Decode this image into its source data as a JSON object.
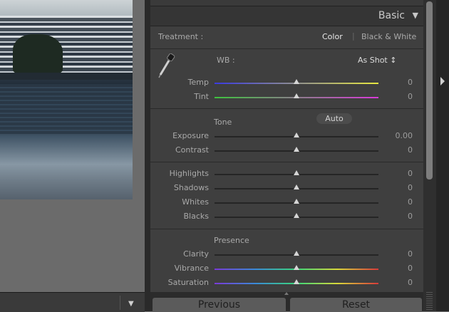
{
  "panel": {
    "title": "Basic",
    "treatment": {
      "label": "Treatment :",
      "options": [
        "Color",
        "Black & White"
      ],
      "active": "Color"
    },
    "wb": {
      "label": "WB :",
      "value": "As Shot ↕",
      "icon": "eyedropper-icon"
    },
    "wb_sliders": [
      {
        "label": "Temp",
        "value": "0",
        "level": 0.5,
        "track": "temp"
      },
      {
        "label": "Tint",
        "value": "0",
        "level": 0.5,
        "track": "tint"
      }
    ],
    "tone": {
      "label": "Tone",
      "auto_label": "Auto",
      "sliders": [
        {
          "label": "Exposure",
          "value": "0.00",
          "level": 0.5
        },
        {
          "label": "Contrast",
          "value": "0",
          "level": 0.5
        }
      ]
    },
    "tone2": {
      "sliders": [
        {
          "label": "Highlights",
          "value": "0",
          "level": 0.5
        },
        {
          "label": "Shadows",
          "value": "0",
          "level": 0.5
        },
        {
          "label": "Whites",
          "value": "0",
          "level": 0.5
        },
        {
          "label": "Blacks",
          "value": "0",
          "level": 0.5
        }
      ]
    },
    "presence": {
      "label": "Presence",
      "sliders": [
        {
          "label": "Clarity",
          "value": "0",
          "level": 0.5,
          "track": "plain"
        },
        {
          "label": "Vibrance",
          "value": "0",
          "level": 0.5,
          "track": "spectrum"
        },
        {
          "label": "Saturation",
          "value": "0",
          "level": 0.5,
          "track": "spectrum"
        }
      ]
    }
  },
  "buttons": {
    "previous": "Previous",
    "reset": "Reset"
  },
  "colors": {
    "temp_track": [
      "#3a3ae0",
      "#e6e640"
    ],
    "tint_track": [
      "#3ec23e",
      "#d83ad8"
    ],
    "spectrum_track": [
      "#7a3ad8",
      "#3a8ad8",
      "#3ad87a",
      "#d8d83a",
      "#d83a3a"
    ]
  }
}
